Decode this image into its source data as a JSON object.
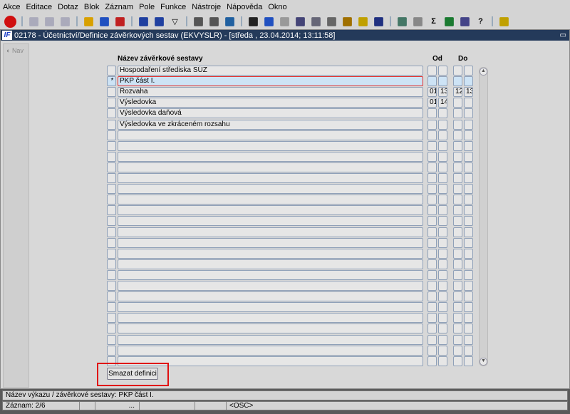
{
  "menu": [
    "Akce",
    "Editace",
    "Dotaz",
    "Blok",
    "Záznam",
    "Pole",
    "Funkce",
    "Nástroje",
    "Nápověda",
    "Okno"
  ],
  "toolbar_icons": [
    "exit-icon",
    "save-icon",
    "print-icon",
    "clear-icon",
    "insert-record-icon",
    "next-icon",
    "delete-record-icon",
    "sort-asc-icon",
    "sort-desc-icon",
    "filter-icon",
    "printer-icon",
    "fax-icon",
    "mail-icon",
    "cut-icon",
    "copy-icon",
    "paste-icon",
    "find-icon",
    "list-icon",
    "settings-icon",
    "gear-icon",
    "sun-icon",
    "triangle-icon",
    "report-icon",
    "calendar-icon",
    "sum-icon",
    "excel-icon",
    "calc-icon",
    "help-icon",
    "context-help-icon"
  ],
  "window": {
    "title": "02178 - Účetnictví/Definice závěrkových sestav (EKVYSLR) - [středa , 23.04.2014; 13:11:58]",
    "nav": "Nav"
  },
  "table": {
    "header_name": "Název závěrkové sestavy",
    "header_from": "Od",
    "header_to": "Do",
    "rows": [
      {
        "mark": "",
        "name": "Hospodaření střediska SÚZ",
        "od1": "",
        "od2": "",
        "do1": "",
        "do2": ""
      },
      {
        "mark": "*",
        "name": "PKP část I.",
        "od1": "",
        "od2": "",
        "do1": "",
        "do2": ""
      },
      {
        "mark": "",
        "name": "Rozvaha",
        "od1": "01",
        "od2": "13",
        "do1": "12",
        "do2": "13"
      },
      {
        "mark": "",
        "name": "Výsledovka",
        "od1": "01",
        "od2": "14",
        "do1": "",
        "do2": ""
      },
      {
        "mark": "",
        "name": "Výsledovka daňová",
        "od1": "",
        "od2": "",
        "do1": "",
        "do2": ""
      },
      {
        "mark": "",
        "name": "Výsledovka ve zkráceném rozsahu",
        "od1": "",
        "od2": "",
        "do1": "",
        "do2": ""
      }
    ],
    "total_rows": 28,
    "selected_index": 1
  },
  "delete_button": "Smazat definici",
  "status": {
    "hint": "Název výkazu / závěrkové sestavy: PKP část I.",
    "record": "Záznam: 2/6",
    "ellipsis": "...",
    "mode": "<OSC>"
  }
}
